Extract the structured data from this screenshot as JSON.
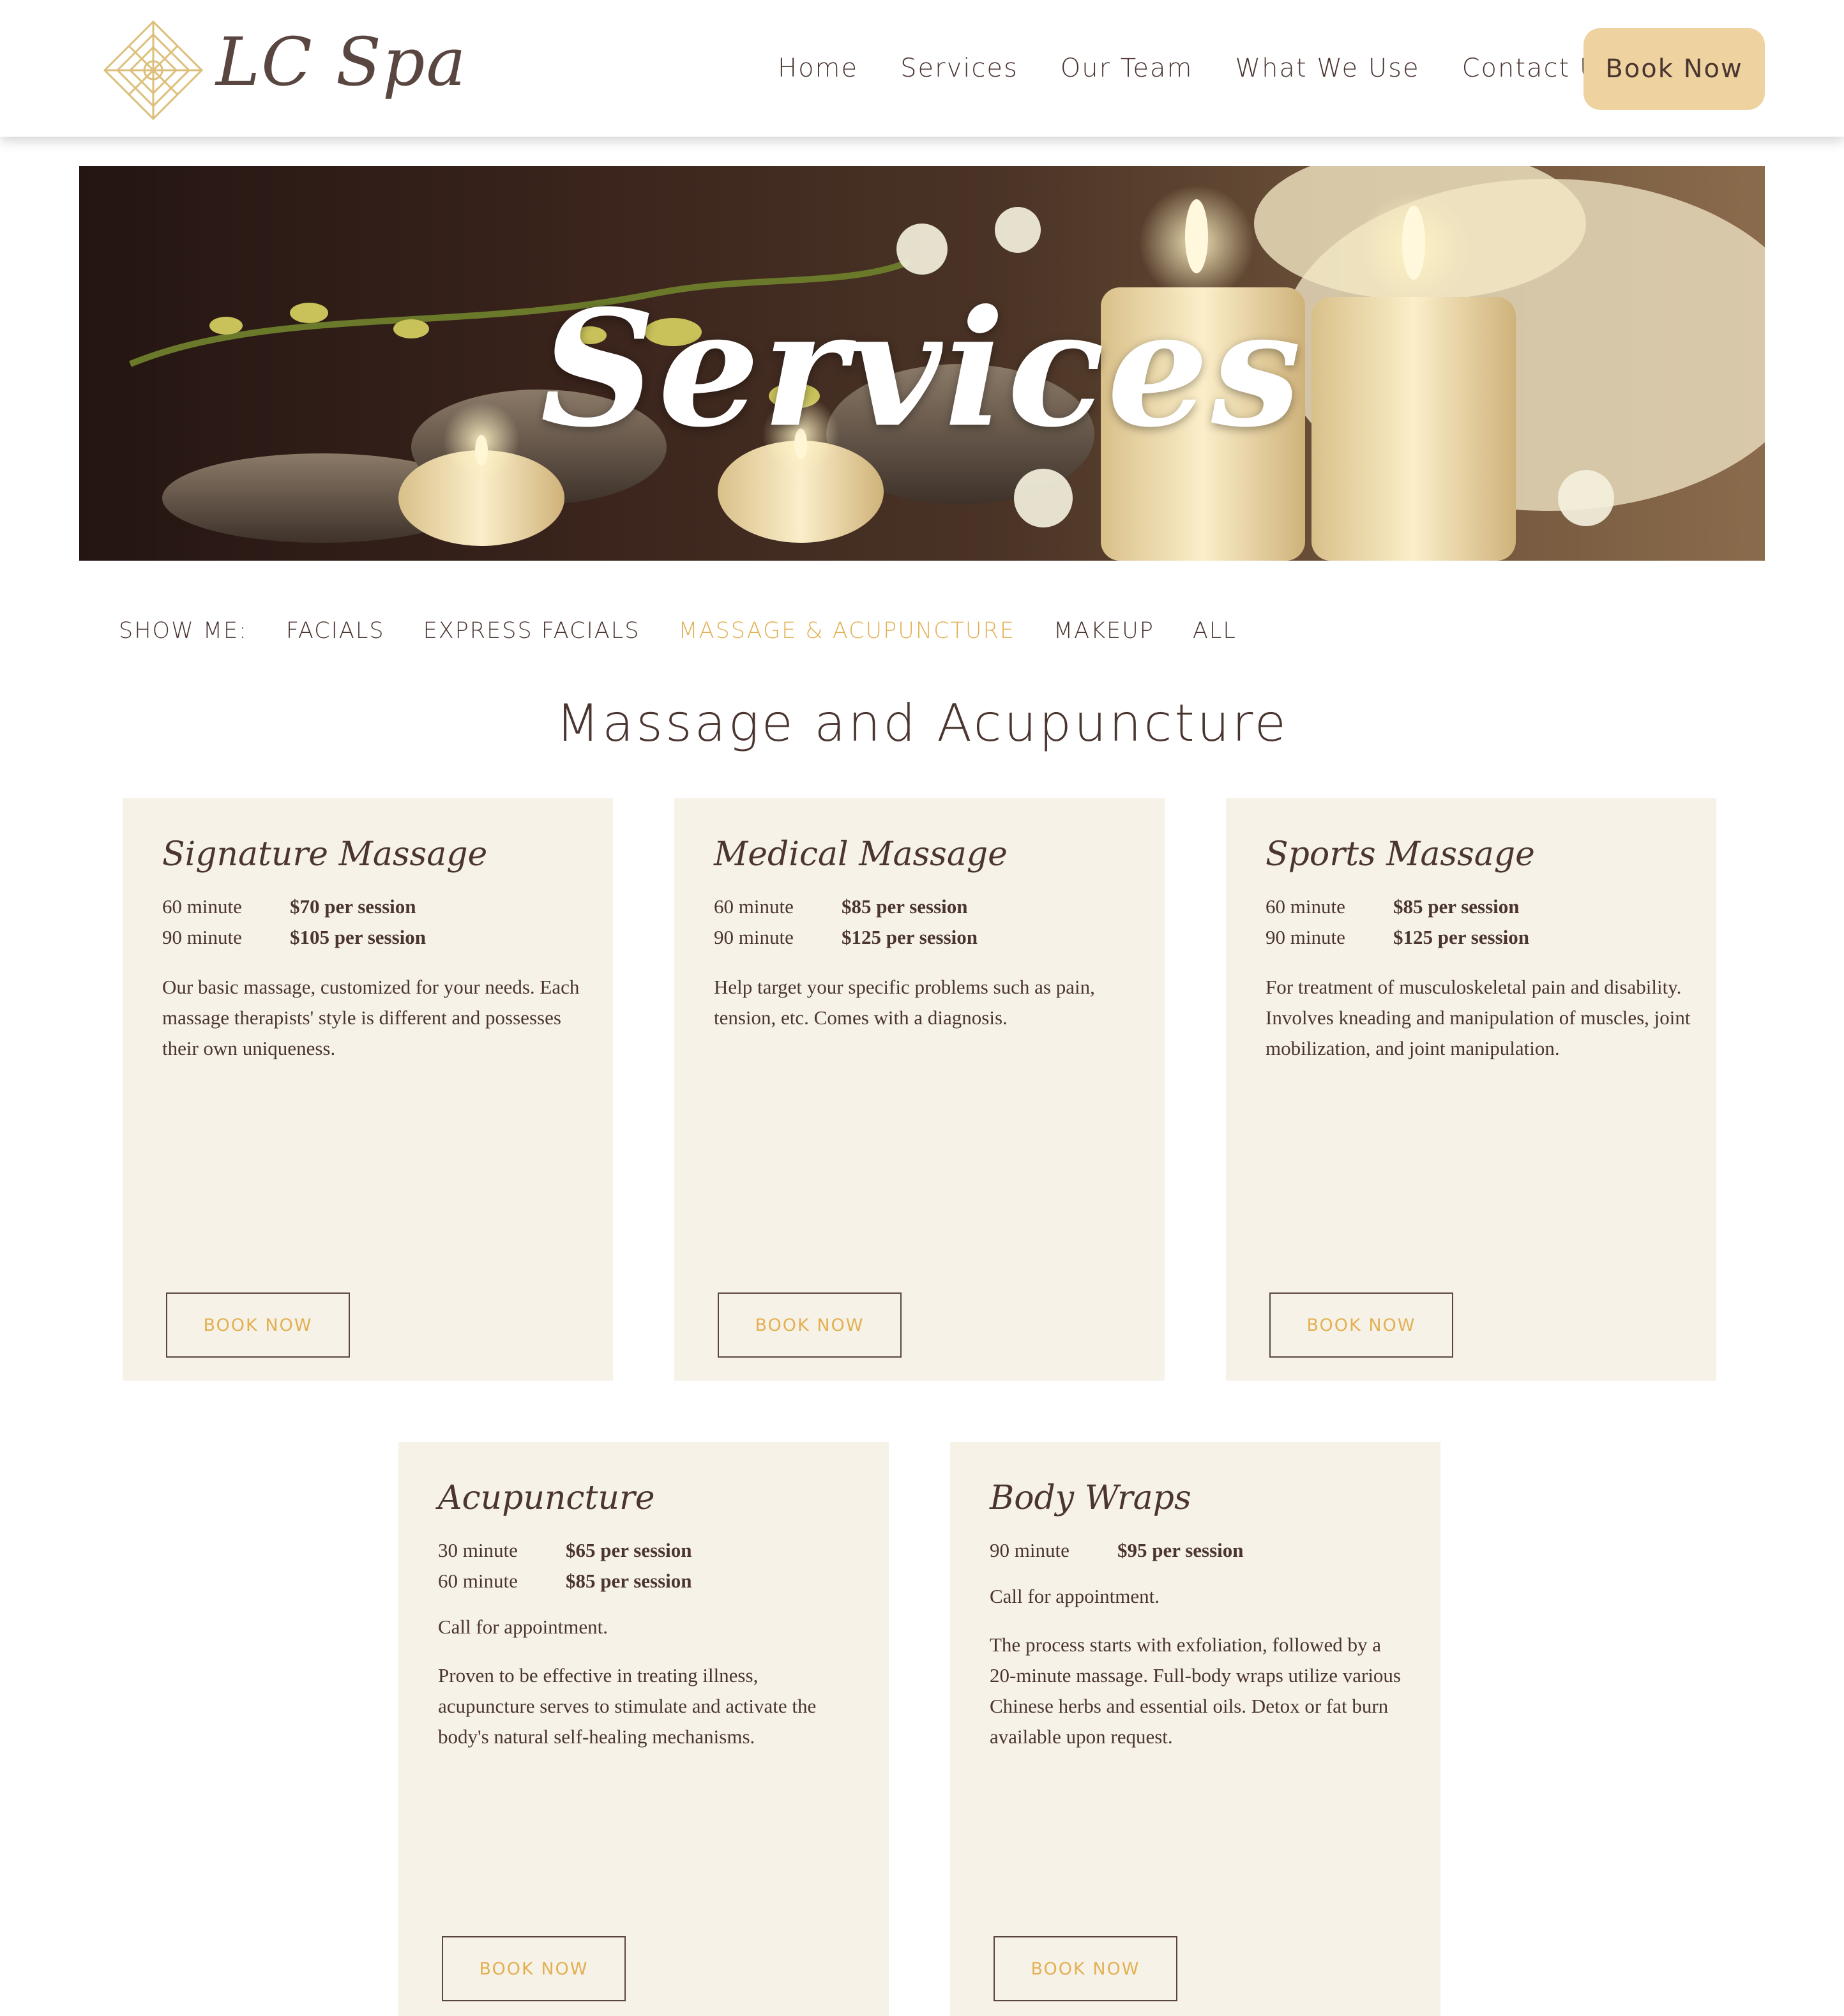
{
  "header": {
    "logo_text": "LC Spa",
    "nav": [
      "Home",
      "Services",
      "Our Team",
      "What We Use",
      "Contact Us"
    ],
    "book_label": "Book Now"
  },
  "hero": {
    "title": "Services"
  },
  "filter": {
    "label": "SHOW ME:",
    "items": [
      "FACIALS",
      "EXPRESS FACIALS",
      "MASSAGE & ACUPUNCTURE",
      "MAKEUP",
      "ALL"
    ],
    "active": "MASSAGE & ACUPUNCTURE"
  },
  "section_title": "Massage and Acupuncture",
  "cards": [
    {
      "title": "Signature Massage",
      "prices": [
        {
          "duration": "60 minute",
          "price": "$70 per session"
        },
        {
          "duration": "90 minute",
          "price": "$105 per session"
        }
      ],
      "note": "",
      "description": "Our basic massage, customized for your needs. Each massage therapists' style is different and possesses their own uniqueness.",
      "button": "BOOK NOW"
    },
    {
      "title": "Medical Massage",
      "prices": [
        {
          "duration": "60 minute",
          "price": "$85 per session"
        },
        {
          "duration": "90 minute",
          "price": "$125 per session"
        }
      ],
      "note": "",
      "description": "Help target your specific problems such as pain, tension, etc. Comes with a diagnosis.",
      "button": "BOOK NOW"
    },
    {
      "title": "Sports Massage",
      "prices": [
        {
          "duration": "60 minute",
          "price": "$85 per session"
        },
        {
          "duration": "90 minute",
          "price": "$125 per session"
        }
      ],
      "note": "",
      "description": "For treatment of musculoskeletal pain and disability. Involves kneading and manipulation of muscles, joint mobilization, and joint manipulation.",
      "button": "BOOK NOW"
    },
    {
      "title": "Acupuncture",
      "prices": [
        {
          "duration": "30 minute",
          "price": "$65 per session"
        },
        {
          "duration": "60 minute",
          "price": "$85 per session"
        }
      ],
      "note": "Call for appointment.",
      "description": "Proven to be effective in treating illness, acupuncture serves to stimulate and activate the body's natural self-healing mechanisms.",
      "button": "BOOK NOW"
    },
    {
      "title": "Body Wraps",
      "prices": [
        {
          "duration": "90 minute",
          "price": "$95 per session"
        }
      ],
      "note": "Call for appointment.",
      "description": "The process starts with exfoliation, followed by a 20-minute massage. Full-body wraps utilize various Chinese herbs and essential oils. Detox or fat burn available upon request.",
      "button": "BOOK NOW"
    }
  ],
  "colors": {
    "accent_gold": "#e2b052",
    "book_button_bg": "#eed3a0",
    "card_bg": "#f7f2e8",
    "text_brown": "#4a3530"
  }
}
